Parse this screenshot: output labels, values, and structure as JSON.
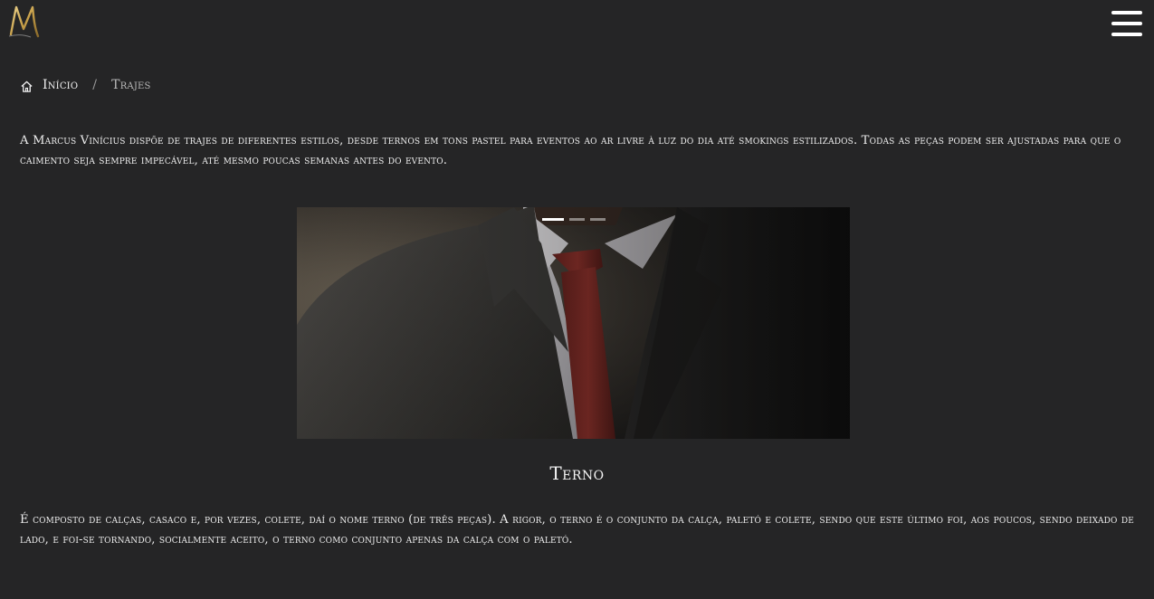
{
  "header": {
    "logo_text": "M",
    "menu_icon": "hamburger-menu-icon",
    "brand_color": "#c9a14a"
  },
  "breadcrumb": {
    "home_icon": "home-icon",
    "home_label": "Início",
    "separator": "/",
    "current_label": "Trajes"
  },
  "intro_text": "A Marcus Vinícius dispõe de trajes de diferentes estilos, desde ternos em tons pastel para eventos ao ar livre à luz do dia até smokings estilizados. Todas as peças podem ser ajustadas para que o caimento seja sempre impecável, até mesmo poucas semanas antes do evento.",
  "carousel": {
    "slide_count": 3,
    "active_index": 0,
    "slide_title": "Terno",
    "slide_description": "É composto de calças, casaco e, por vezes, colete, daí o nome terno (de três peças). A rigor, o terno é o conjunto da calça, paletó e colete, sendo que este último foi, aos poucos, sendo deixado de lado, e foi-se tornando, socialmente aceito, o terno como conjunto apenas da calça com o paletó."
  },
  "colors": {
    "background": "#252526",
    "text": "#ececec",
    "tie": "#8c2a25"
  }
}
